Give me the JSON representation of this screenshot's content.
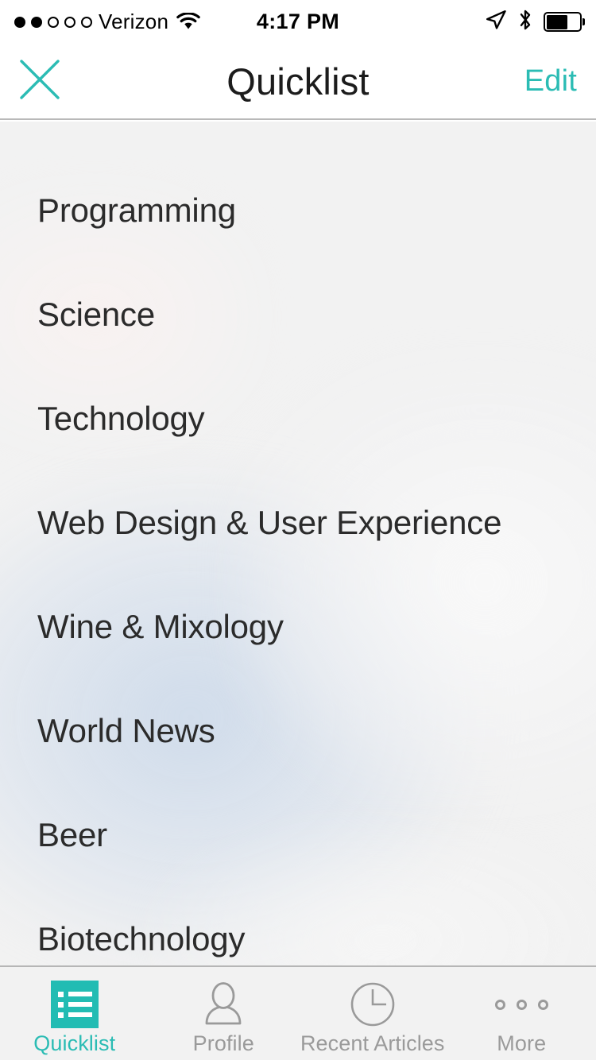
{
  "status_bar": {
    "carrier": "Verizon",
    "signal_dots_total": 5,
    "signal_dots_filled": 2,
    "time": "4:17 PM",
    "wifi_icon": "wifi-icon",
    "location_icon": "location-arrow-icon",
    "bluetooth_icon": "bluetooth-icon",
    "battery_icon": "battery-icon",
    "battery_level_percent": 57
  },
  "nav_bar": {
    "close_label": "close-icon",
    "title": "Quicklist",
    "edit_label": "Edit"
  },
  "colors": {
    "accent": "#2bbcb4",
    "tab_icon_teal": "#22bcb3",
    "text_primary": "#2b2b2b",
    "text_muted": "#9a9a9a",
    "background": "#f2f2f2",
    "divider": "#b6b6b6"
  },
  "list": {
    "items": [
      {
        "label": "Programming"
      },
      {
        "label": "Science"
      },
      {
        "label": "Technology"
      },
      {
        "label": "Web Design & User Experience"
      },
      {
        "label": "Wine & Mixology"
      },
      {
        "label": "World News"
      },
      {
        "label": "Beer"
      },
      {
        "label": "Biotechnology"
      }
    ]
  },
  "tab_bar": {
    "tabs": [
      {
        "label": "Quicklist",
        "icon": "list-icon",
        "active": true
      },
      {
        "label": "Profile",
        "icon": "person-icon",
        "active": false
      },
      {
        "label": "Recent Articles",
        "icon": "clock-icon",
        "active": false
      },
      {
        "label": "More",
        "icon": "ellipsis-icon",
        "active": false
      }
    ]
  }
}
